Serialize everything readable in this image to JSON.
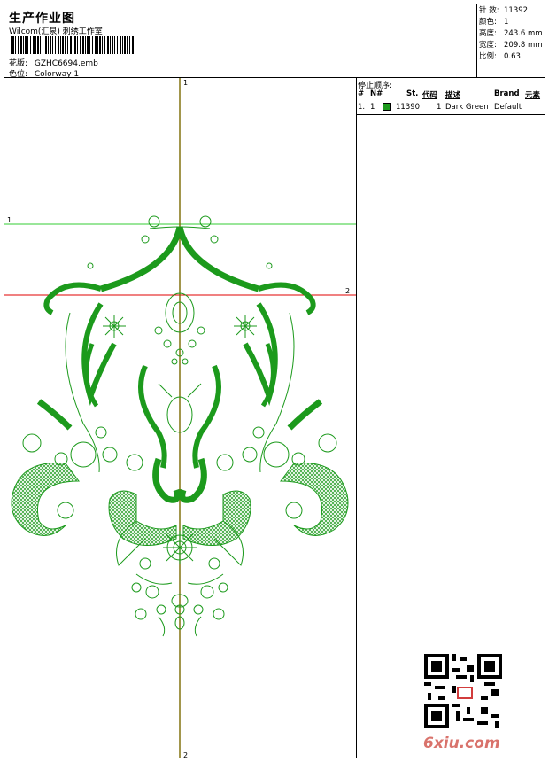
{
  "header": {
    "title": "生产作业图",
    "subtitle": "Wilcom(汇泉) 刺绣工作室",
    "design_label": "花版:",
    "design_value": "GZHC6694.emb",
    "colorway_label": "色位:",
    "colorway_value": "Colorway 1"
  },
  "stats": [
    {
      "label": "针 数:",
      "value": "11392"
    },
    {
      "label": "颜色:",
      "value": "1"
    },
    {
      "label": "高度:",
      "value": "243.6 mm"
    },
    {
      "label": "宽度:",
      "value": "209.8 mm"
    },
    {
      "label": "比例:",
      "value": "0.63"
    }
  ],
  "canvas": {
    "vertical_top_marker": "1",
    "vertical_bottom_marker": "2",
    "horizontal_green_marker": "1",
    "horizontal_red_marker": "2",
    "colors": {
      "vertical": "#7a6a00",
      "green_line": "#33cc33",
      "red_line": "#e00000",
      "stitch": "#1c9a1c"
    }
  },
  "stop_sequence": {
    "title": "停止顺序:",
    "columns": [
      "#",
      "N#",
      "St.",
      "代码",
      "描述",
      "Brand",
      "元素"
    ],
    "rows": [
      {
        "index": "1.",
        "needle": "1",
        "color": "#1c9a1c",
        "stitches": "11390",
        "code": "1",
        "description": "Dark Green",
        "brand": "Default",
        "element": ""
      }
    ]
  },
  "watermark": "6xiu.com"
}
